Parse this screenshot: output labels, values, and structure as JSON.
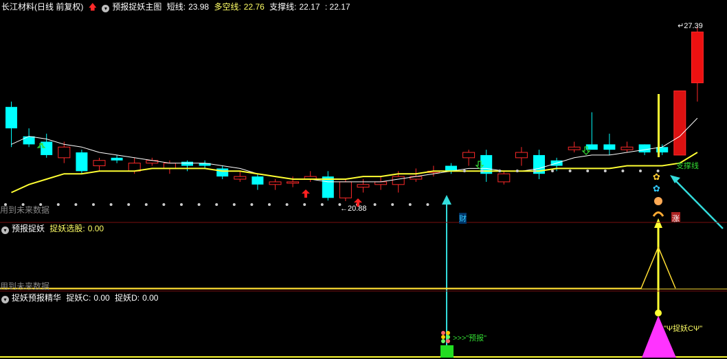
{
  "header": {
    "stock_title": "长江材料(日线 前复权)",
    "indicator_name": "预报捉妖主图",
    "short_line_label": "短线:",
    "short_line_value": "23.98",
    "bull_bear_label": "多空线:",
    "bull_bear_value": "22.76",
    "support_label": "支撑线:",
    "support_value": "22.17",
    "support_value2": ": 22.17"
  },
  "panel2": {
    "name": "预报捉妖",
    "field_label": "捉妖选股:",
    "field_value": "0.00",
    "watermark": "用到未来数据"
  },
  "panel3": {
    "name": "捉妖预报精华",
    "c_label": "捉妖C:",
    "c_value": "0.00",
    "d_label": "捉妖D:",
    "d_value": "0.00"
  },
  "main": {
    "watermark": "用到未来数据",
    "high_price_label": "27.39",
    "low_price_label": "20.88",
    "support_line_label": "支撑线",
    "cai_label": "财",
    "zhang_label": "涨",
    "forecast_label": ">>>\"预报\"",
    "catch_label": "\"Ψ捉妖CΨ\""
  },
  "colors": {
    "up": "#ff2a2a",
    "down": "#00ffff",
    "support_line": "#ffff33",
    "short_line": "#ffffff",
    "arrow_cyan": "#33cccc",
    "magenta": "#ff33ff",
    "divider": "#7a1010"
  },
  "chart_data": {
    "type": "candlestick",
    "high": 27.39,
    "low": 20.88,
    "candles": [
      {
        "o": 24.4,
        "c": 23.6,
        "h": 24.6,
        "l": 22.9
      },
      {
        "o": 23.3,
        "c": 23.0,
        "h": 23.6,
        "l": 22.9
      },
      {
        "o": 23.1,
        "c": 22.6,
        "h": 23.4,
        "l": 22.5
      },
      {
        "o": 22.5,
        "c": 22.9,
        "h": 23.1,
        "l": 22.3
      },
      {
        "o": 22.7,
        "c": 22.0,
        "h": 22.8,
        "l": 21.9
      },
      {
        "o": 22.2,
        "c": 22.4,
        "h": 22.5,
        "l": 22.0
      },
      {
        "o": 22.5,
        "c": 22.4,
        "h": 22.6,
        "l": 22.3
      },
      {
        "o": 22.0,
        "c": 22.3,
        "h": 22.5,
        "l": 21.9
      },
      {
        "o": 22.3,
        "c": 22.4,
        "h": 22.5,
        "l": 22.2
      },
      {
        "o": 22.1,
        "c": 22.3,
        "h": 22.4,
        "l": 21.9
      },
      {
        "o": 22.35,
        "c": 22.2,
        "h": 22.4,
        "l": 22.0
      },
      {
        "o": 22.3,
        "c": 22.2,
        "h": 22.4,
        "l": 22.1
      },
      {
        "o": 22.1,
        "c": 21.8,
        "h": 22.2,
        "l": 21.7
      },
      {
        "o": 21.7,
        "c": 21.8,
        "h": 22.0,
        "l": 21.6
      },
      {
        "o": 21.8,
        "c": 21.5,
        "h": 21.9,
        "l": 21.3
      },
      {
        "o": 21.5,
        "c": 21.6,
        "h": 21.7,
        "l": 21.3
      },
      {
        "o": 21.6,
        "c": 21.6,
        "h": 21.8,
        "l": 21.4
      },
      {
        "o": 21.7,
        "c": 21.8,
        "h": 22.0,
        "l": 21.6
      },
      {
        "o": 21.8,
        "c": 21.0,
        "h": 22.0,
        "l": 20.9
      },
      {
        "o": 21.0,
        "c": 21.6,
        "h": 21.7,
        "l": 20.88
      },
      {
        "o": 21.4,
        "c": 21.5,
        "h": 21.7,
        "l": 21.2
      },
      {
        "o": 21.5,
        "c": 21.6,
        "h": 21.8,
        "l": 21.3
      },
      {
        "o": 21.5,
        "c": 21.8,
        "h": 22.0,
        "l": 21.2
      },
      {
        "o": 21.7,
        "c": 21.8,
        "h": 22.1,
        "l": 21.6
      },
      {
        "o": 22.0,
        "c": 22.0,
        "h": 22.2,
        "l": 21.8
      },
      {
        "o": 22.2,
        "c": 22.0,
        "h": 22.3,
        "l": 21.9
      },
      {
        "o": 22.5,
        "c": 22.7,
        "h": 22.8,
        "l": 22.2
      },
      {
        "o": 22.6,
        "c": 21.9,
        "h": 22.8,
        "l": 21.6
      },
      {
        "o": 21.6,
        "c": 21.9,
        "h": 22.0,
        "l": 21.5
      },
      {
        "o": 22.5,
        "c": 22.7,
        "h": 22.9,
        "l": 22.2
      },
      {
        "o": 22.6,
        "c": 21.9,
        "h": 22.8,
        "l": 21.7
      },
      {
        "o": 22.4,
        "c": 22.2,
        "h": 22.5,
        "l": 22.0
      },
      {
        "o": 22.8,
        "c": 22.9,
        "h": 23.1,
        "l": 22.7
      },
      {
        "o": 23.0,
        "c": 22.8,
        "h": 24.2,
        "l": 22.9
      },
      {
        "o": 23.0,
        "c": 22.8,
        "h": 23.4,
        "l": 22.6
      },
      {
        "o": 22.8,
        "c": 22.9,
        "h": 23.1,
        "l": 22.7
      },
      {
        "o": 23.0,
        "c": 22.7,
        "h": 23.0,
        "l": 22.6
      },
      {
        "o": 22.9,
        "c": 22.7,
        "h": 23.0,
        "l": 22.6
      },
      {
        "o": 22.6,
        "c": 25.0,
        "h": 25.0,
        "l": 22.6
      },
      {
        "o": 25.3,
        "c": 27.2,
        "h": 27.39,
        "l": 24.6
      }
    ],
    "short_line": [
      23.0,
      23.3,
      23.2,
      23.0,
      22.9,
      22.7,
      22.6,
      22.5,
      22.4,
      22.3,
      22.3,
      22.3,
      22.2,
      22.1,
      21.9,
      21.8,
      21.7,
      21.7,
      21.6,
      21.6,
      21.6,
      21.6,
      21.7,
      21.8,
      21.9,
      22.0,
      22.1,
      22.1,
      22.0,
      22.0,
      22.1,
      22.3,
      22.5,
      22.6,
      22.6,
      22.7,
      22.8,
      22.9,
      23.3,
      23.98
    ],
    "support_line": [
      21.2,
      21.5,
      21.7,
      21.9,
      21.9,
      22.0,
      22.0,
      22.0,
      22.1,
      22.1,
      22.1,
      22.1,
      22.0,
      22.0,
      21.9,
      21.8,
      21.7,
      21.7,
      21.7,
      21.7,
      21.8,
      21.8,
      21.9,
      21.9,
      22.0,
      22.0,
      22.0,
      22.0,
      22.0,
      22.0,
      22.0,
      22.1,
      22.1,
      22.1,
      22.1,
      22.2,
      22.2,
      22.2,
      22.3,
      22.7
    ]
  }
}
